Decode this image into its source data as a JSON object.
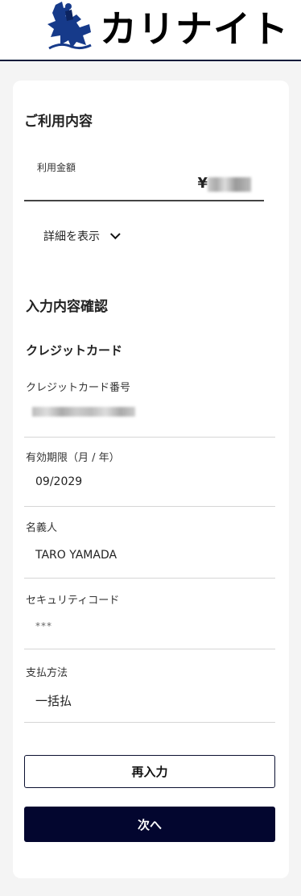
{
  "header": {
    "logo_text": "カリナイト"
  },
  "usage": {
    "title": "ご利用内容",
    "amount_label": "利用金額",
    "currency": "¥",
    "detail_toggle": "詳細を表示"
  },
  "confirm": {
    "title": "入力内容確認",
    "section_title": "クレジットカード",
    "fields": [
      {
        "label": "クレジットカード番号",
        "value": ""
      },
      {
        "label": "有効期限（月 / 年）",
        "value": "09/2029"
      },
      {
        "label": "名義人",
        "value": "TARO YAMADA"
      },
      {
        "label": "セキュリティコード",
        "value": "***"
      },
      {
        "label": "支払方法",
        "value": "一括払"
      }
    ]
  },
  "buttons": {
    "reenter": "再入力",
    "next": "次へ"
  },
  "colors": {
    "primary": "#03062f",
    "header_border": "#0b1a3a",
    "page_bg": "#f4f4f4"
  }
}
